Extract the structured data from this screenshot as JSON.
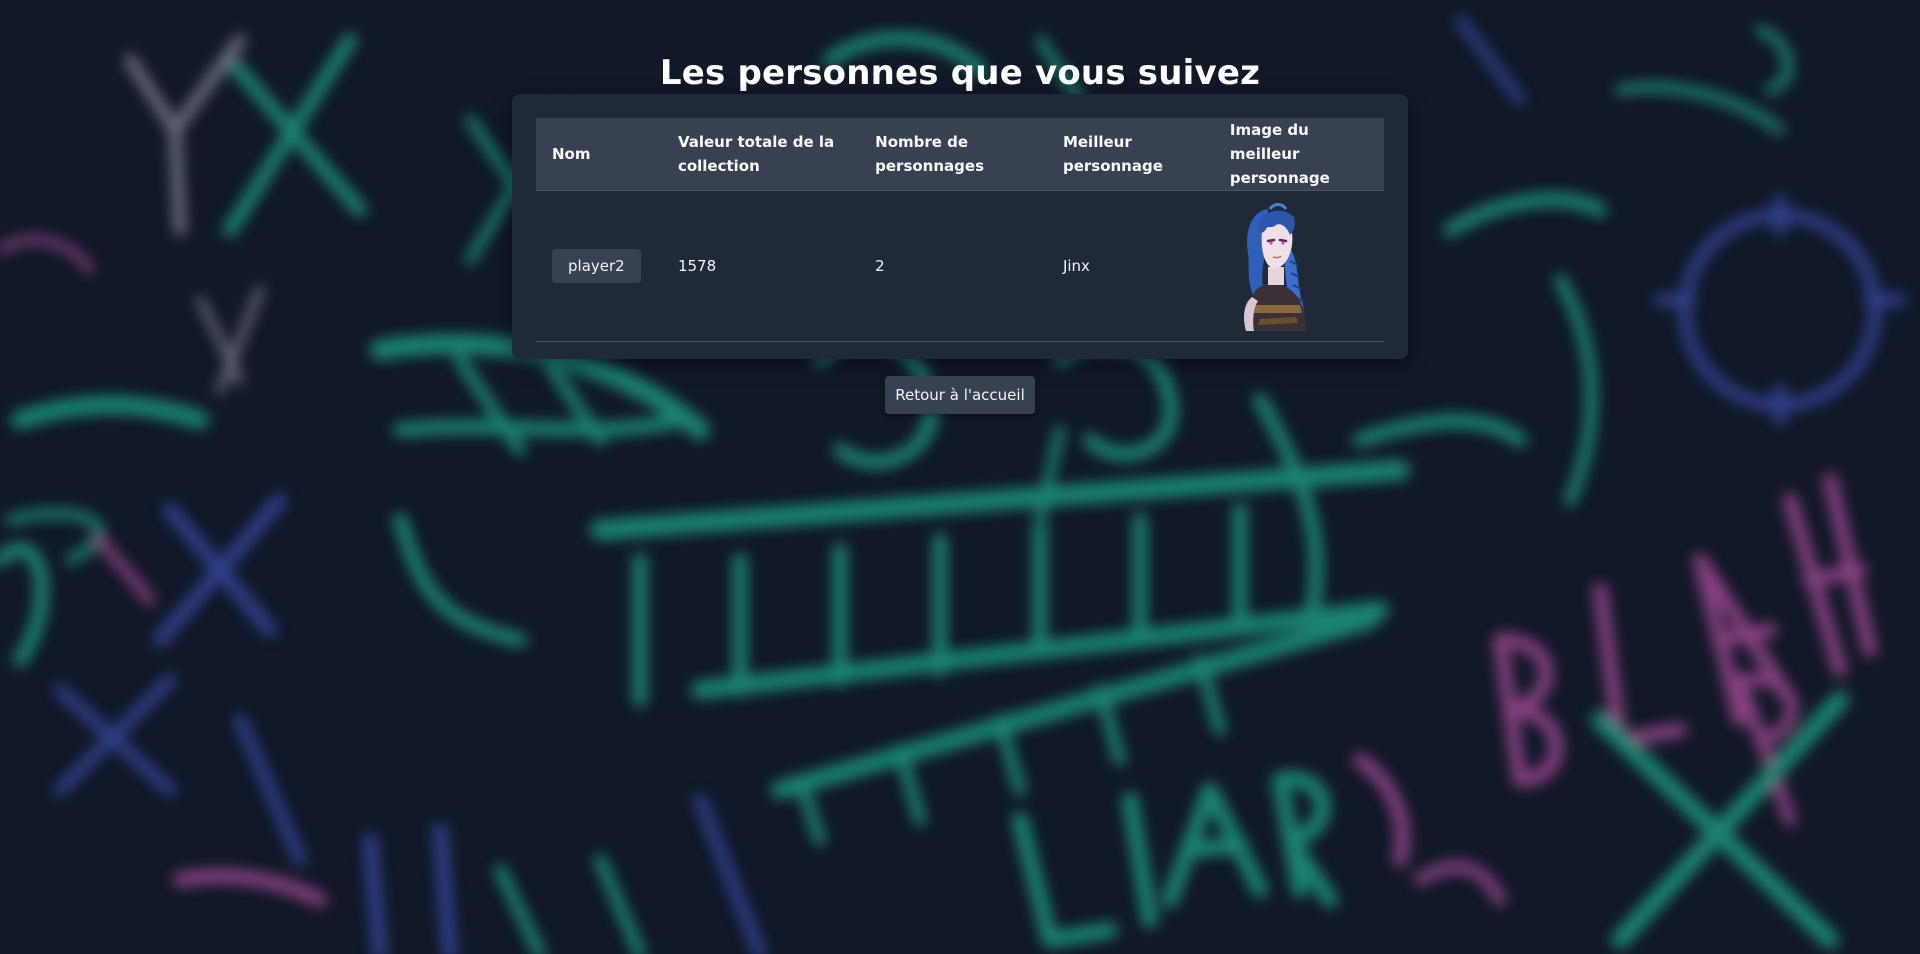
{
  "page": {
    "title": "Les personnes que vous suivez"
  },
  "table": {
    "headers": {
      "name": "Nom",
      "total_value": "Valeur totale de la collection",
      "character_count": "Nombre de personnages",
      "best_character": "Meilleur personnage",
      "best_character_image": "Image du meilleur personnage"
    },
    "rows": [
      {
        "name": "player2",
        "total_value": "1578",
        "character_count": "2",
        "best_character": "Jinx"
      }
    ]
  },
  "actions": {
    "back_label": "Retour à l'accueil"
  },
  "colors": {
    "background": "#111827",
    "panel": "#1f2937",
    "header_row": "#374151",
    "button": "#374151",
    "graffiti_teal": "#1fa88a",
    "graffiti_blue": "#3b4fb0",
    "graffiti_pink": "#b04fa0"
  }
}
